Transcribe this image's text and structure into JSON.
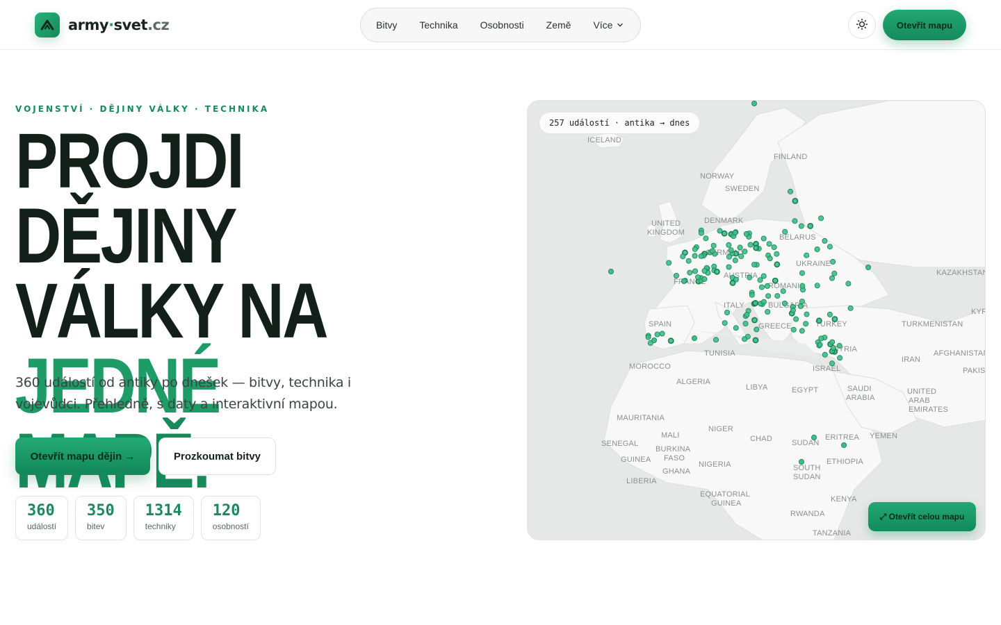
{
  "brand": {
    "name_main": "army",
    "name_dot": "·",
    "name_second": "svet",
    "name_tld": ".cz"
  },
  "nav": {
    "items": [
      {
        "label": "Bitvy"
      },
      {
        "label": "Technika"
      },
      {
        "label": "Osobnosti"
      },
      {
        "label": "Země"
      },
      {
        "label": "Více"
      }
    ]
  },
  "header": {
    "cta_label": "Otevřít mapu"
  },
  "icons": {
    "logo": "chevron-up-logo-icon",
    "theme": "sun-icon",
    "more": "chevron-down-icon",
    "arrow": "arrow-right-icon",
    "expand": "expand-icon"
  },
  "colors": {
    "accent": "#1f9b68",
    "accent_dark": "#138a5b",
    "text": "#122019"
  },
  "hero": {
    "eyebrow": "VOJENSTVÍ · DĚJINY VÁLKY · TECHNIKA",
    "headline_line1": "PROJDI DĚJINY",
    "headline_line2a": "VÁLKY NA ",
    "headline_line2b": "JEDNÉ",
    "headline_line3": "MAPĚ.",
    "lead": "360 událostí od antiky po dnešek — bitvy, technika i vojevůdci. Přehledně, s daty a interaktivní mapou.",
    "primary_label": "Otevřít mapu dějin →",
    "secondary_label": "Prozkoumat bitvy"
  },
  "stats": [
    {
      "value": "360",
      "label": "událostí"
    },
    {
      "value": "350",
      "label": "bitev"
    },
    {
      "value": "1314",
      "label": "techniky"
    },
    {
      "value": "120",
      "label": "osobností"
    }
  ],
  "map": {
    "badge": "257 událostí · antika → dnes",
    "cta_label": "⤢ Otevřít celou mapu",
    "countries": [
      "ICELAND",
      "FINLAND",
      "NORWAY",
      "SWEDEN",
      "UNITED",
      "KINGDOM",
      "DENMARK",
      "BELARUS",
      "GERMANY",
      "UKRAINE",
      "AUSTRIA",
      "FRANCE",
      "ROMANIA",
      "ITALY",
      "BULGARIA",
      "SPAIN",
      "GREECE",
      "TURKEY",
      "TURKMENISTAN",
      "KAZAKHSTAN",
      "SYRIA",
      "TUNISIA",
      "IRAN",
      "AFGHANISTAN",
      "MOROCCO",
      "ISRAEL",
      "ALGERIA",
      "LIBYA",
      "EGYPT",
      "SAUDI",
      "ARABIA",
      "UNITED",
      "ARAB",
      "EMIRATES",
      "MAURITANIA",
      "NIGER",
      "MALI",
      "CHAD",
      "SUDAN",
      "ERITREA",
      "YEMEN",
      "SENEGAL",
      "BURKINA",
      "FASO",
      "GUINEA",
      "NIGERIA",
      "GHANA",
      "ETHIOPIA",
      "SOUTH",
      "SUDAN",
      "LIBERIA",
      "EQUATORIAL",
      "GUINEA",
      "KENYA",
      "RWANDA",
      "TANZANIA",
      "PAKIS",
      "KYR"
    ]
  }
}
